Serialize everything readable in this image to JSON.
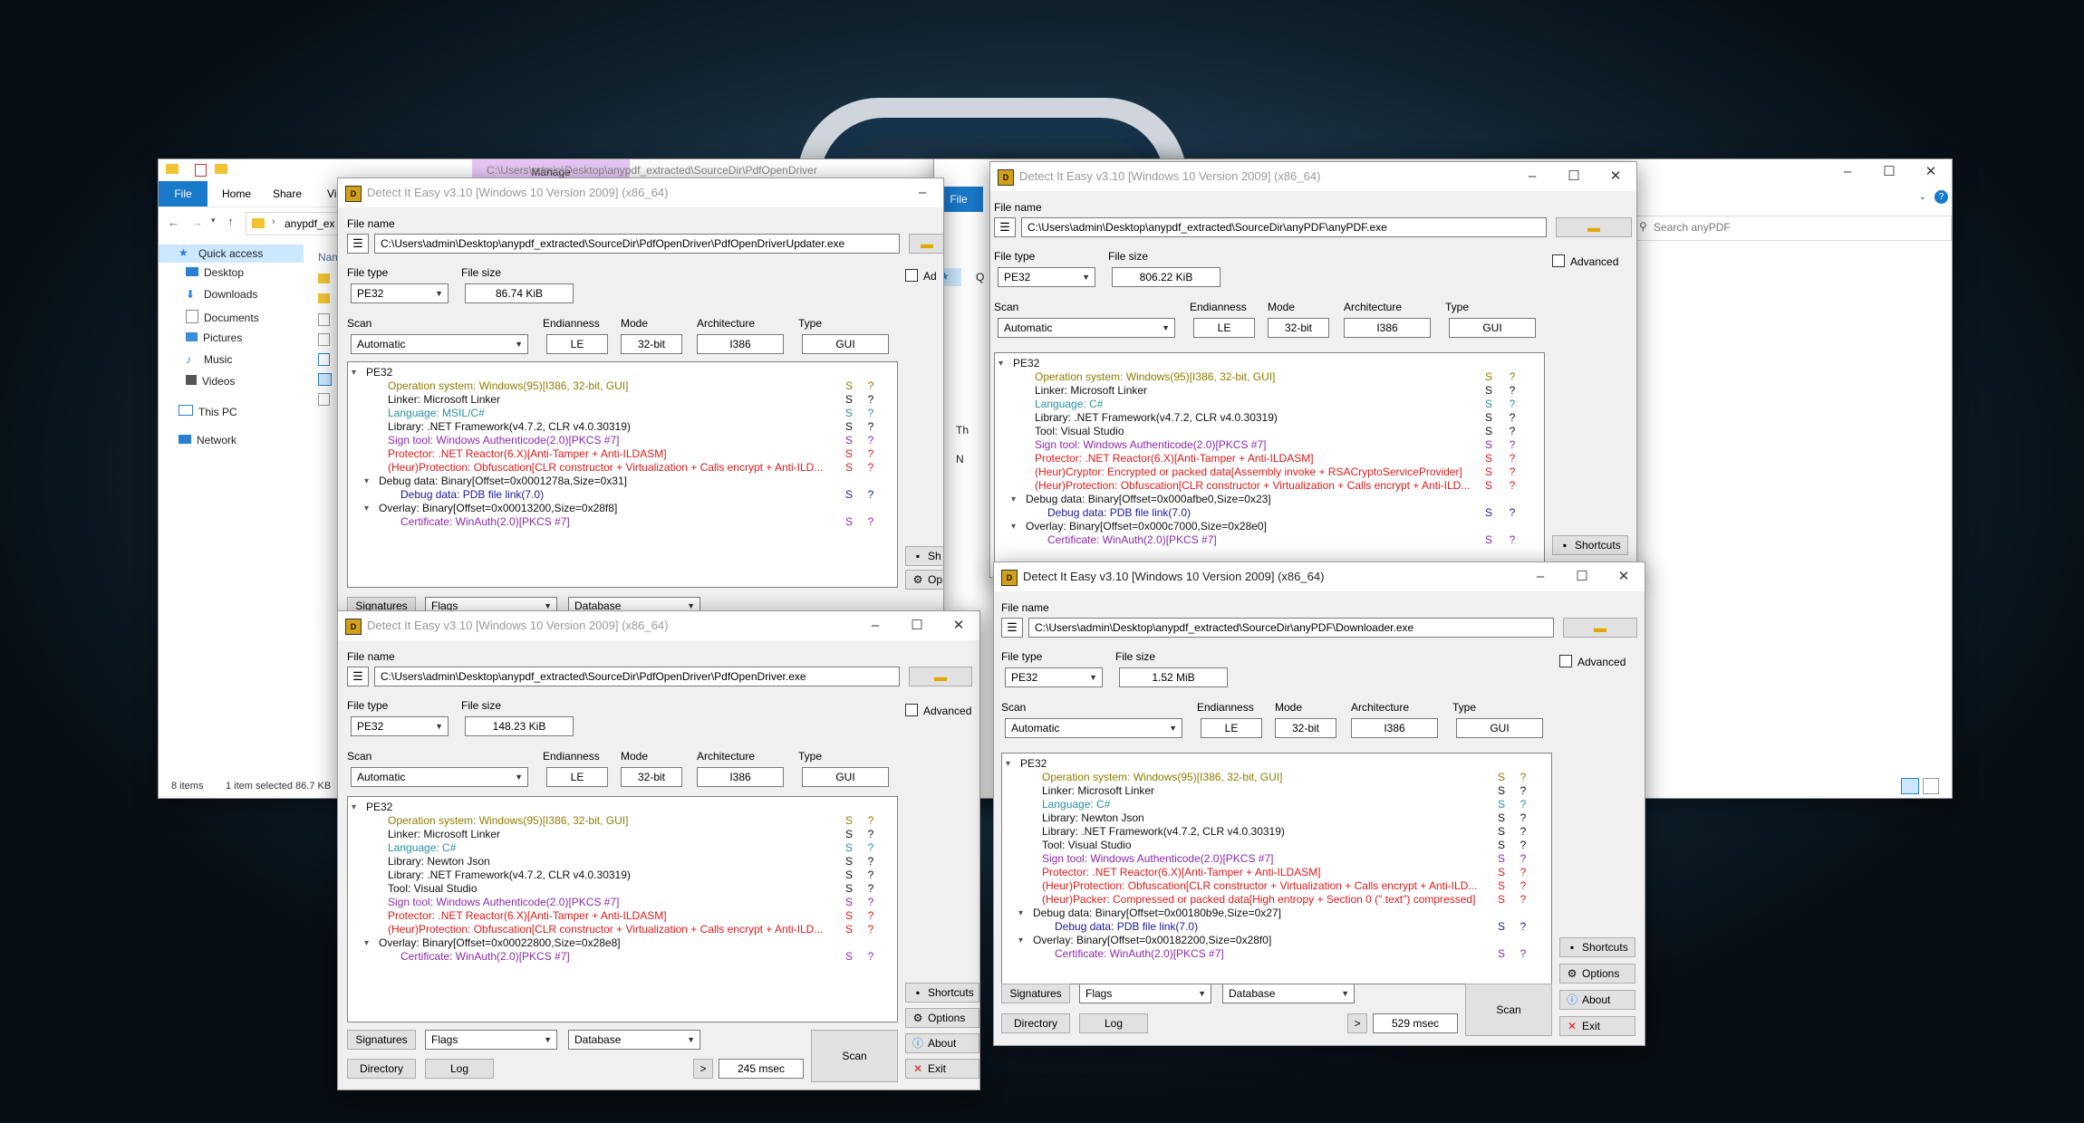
{
  "colors": {
    "teal": "#2a8f9c",
    "olive": "#8b7d00",
    "purple": "#8a2ab0",
    "red": "#e01a1a",
    "navy": "#1a1aa0",
    "black": "#111111"
  },
  "explorer": {
    "manage_tab": "Manage",
    "path_title": "C:\\Users\\admin\\Desktop\\anypdf_extracted\\SourceDir\\PdfOpenDriver",
    "ribbon": {
      "file": "File",
      "home": "Home",
      "share": "Share",
      "view": "Vi"
    },
    "address": "anypdf_ex",
    "column_name": "Nam",
    "nav": [
      {
        "label": "Quick access",
        "icon": "star-icon"
      },
      {
        "label": "Desktop",
        "icon": "desktop-icon"
      },
      {
        "label": "Downloads",
        "icon": "downloads-icon"
      },
      {
        "label": "Documents",
        "icon": "documents-icon"
      },
      {
        "label": "Pictures",
        "icon": "pictures-icon"
      },
      {
        "label": "Music",
        "icon": "music-icon"
      },
      {
        "label": "Videos",
        "icon": "videos-icon"
      },
      {
        "label": "This PC",
        "icon": "pc-icon"
      },
      {
        "label": "Network",
        "icon": "network-icon"
      }
    ],
    "status_items": "8 items",
    "status_selected": "1 item selected  86.7 KB"
  },
  "explorer2": {
    "file": "File",
    "search_placeholder": "Search anyPDF",
    "nav_q": "Q",
    "nav_th": "Th",
    "nav_n": "N"
  },
  "common": {
    "file_name": "File name",
    "file_type": "File type",
    "file_size": "File size",
    "scan": "Scan",
    "endianness": "Endianness",
    "mode": "Mode",
    "architecture": "Architecture",
    "type": "Type",
    "advanced": "Advanced",
    "signatures": "Signatures",
    "flags": "Flags",
    "database": "Database",
    "directory": "Directory",
    "log": "Log",
    "scan_btn": "Scan",
    "next": ">",
    "shortcuts": "Shortcuts",
    "options": "Options",
    "about": "About",
    "exit": "Exit",
    "sh_partial": "Sh",
    "op_partial": "Op",
    "ad_partial": "Ad",
    "s": "S",
    "q": "?"
  },
  "die1": {
    "title": "Detect It Easy v3.10 [Windows 10 Version 2009] (x86_64)",
    "path": "C:\\Users\\admin\\Desktop\\anypdf_extracted\\SourceDir\\PdfOpenDriver\\PdfOpenDriverUpdater.exe",
    "file_type": "PE32",
    "file_size": "86.74 KiB",
    "scan_mode": "Automatic",
    "endianness": "LE",
    "mode": "32-bit",
    "architecture": "I386",
    "type": "GUI",
    "results": [
      {
        "text": "PE32",
        "level": 0,
        "color": "black",
        "exp": true,
        "sq": false
      },
      {
        "text": "Operation system: Windows(95)[I386, 32-bit, GUI]",
        "level": 1,
        "color": "olive",
        "sq": true
      },
      {
        "text": "Linker: Microsoft Linker",
        "level": 1,
        "color": "black",
        "sq": true
      },
      {
        "text": "Language: MSIL/C#",
        "level": 1,
        "color": "teal",
        "sq": true
      },
      {
        "text": "Library: .NET Framework(v4.7.2, CLR v4.0.30319)",
        "level": 1,
        "color": "black",
        "sq": true
      },
      {
        "text": "Sign tool: Windows Authenticode(2.0)[PKCS #7]",
        "level": 1,
        "color": "purple",
        "sq": true
      },
      {
        "text": "Protector: .NET Reactor(6.X)[Anti-Tamper + Anti-ILDASM]",
        "level": 1,
        "color": "red",
        "sq": true
      },
      {
        "text": "(Heur)Protection: Obfuscation[CLR constructor + Virtualization + Calls encrypt + Anti-ILD...",
        "level": 1,
        "color": "red",
        "sq": true
      },
      {
        "text": "Debug data: Binary[Offset=0x0001278a,Size=0x31]",
        "level": 1,
        "color": "black",
        "exp": true,
        "sq": false
      },
      {
        "text": "Debug data: PDB file link(7.0)",
        "level": 2,
        "color": "navy",
        "sq": true
      },
      {
        "text": "Overlay: Binary[Offset=0x00013200,Size=0x28f8]",
        "level": 1,
        "color": "black",
        "exp": true,
        "sq": false
      },
      {
        "text": "Certificate: WinAuth(2.0)[PKCS #7]",
        "level": 2,
        "color": "purple",
        "sq": true
      }
    ]
  },
  "die2": {
    "title": "Detect It Easy v3.10 [Windows 10 Version 2009] (x86_64)",
    "path": "C:\\Users\\admin\\Desktop\\anypdf_extracted\\SourceDir\\PdfOpenDriver\\PdfOpenDriver.exe",
    "file_type": "PE32",
    "file_size": "148.23 KiB",
    "scan_mode": "Automatic",
    "endianness": "LE",
    "mode": "32-bit",
    "architecture": "I386",
    "type": "GUI",
    "time": "245 msec",
    "results": [
      {
        "text": "PE32",
        "level": 0,
        "color": "black",
        "exp": true,
        "sq": false
      },
      {
        "text": "Operation system: Windows(95)[I386, 32-bit, GUI]",
        "level": 1,
        "color": "olive",
        "sq": true
      },
      {
        "text": "Linker: Microsoft Linker",
        "level": 1,
        "color": "black",
        "sq": true
      },
      {
        "text": "Language: C#",
        "level": 1,
        "color": "teal",
        "sq": true
      },
      {
        "text": "Library: Newton Json",
        "level": 1,
        "color": "black",
        "sq": true
      },
      {
        "text": "Library: .NET Framework(v4.7.2, CLR v4.0.30319)",
        "level": 1,
        "color": "black",
        "sq": true
      },
      {
        "text": "Tool: Visual Studio",
        "level": 1,
        "color": "black",
        "sq": true
      },
      {
        "text": "Sign tool: Windows Authenticode(2.0)[PKCS #7]",
        "level": 1,
        "color": "purple",
        "sq": true
      },
      {
        "text": "Protector: .NET Reactor(6.X)[Anti-Tamper + Anti-ILDASM]",
        "level": 1,
        "color": "red",
        "sq": true
      },
      {
        "text": "(Heur)Protection: Obfuscation[CLR constructor + Virtualization + Calls encrypt + Anti-ILD...",
        "level": 1,
        "color": "red",
        "sq": true
      },
      {
        "text": "Overlay: Binary[Offset=0x00022800,Size=0x28e8]",
        "level": 1,
        "color": "black",
        "exp": true,
        "sq": false
      },
      {
        "text": "Certificate: WinAuth(2.0)[PKCS #7]",
        "level": 2,
        "color": "purple",
        "sq": true
      }
    ]
  },
  "die3": {
    "title": "Detect It Easy v3.10 [Windows 10 Version 2009] (x86_64)",
    "path": "C:\\Users\\admin\\Desktop\\anypdf_extracted\\SourceDir\\anyPDF\\anyPDF.exe",
    "file_type": "PE32",
    "file_size": "806.22 KiB",
    "scan_mode": "Automatic",
    "endianness": "LE",
    "mode": "32-bit",
    "architecture": "I386",
    "type": "GUI",
    "results": [
      {
        "text": "PE32",
        "level": 0,
        "color": "black",
        "exp": true,
        "sq": false
      },
      {
        "text": "Operation system: Windows(95)[I386, 32-bit, GUI]",
        "level": 1,
        "color": "olive",
        "sq": true
      },
      {
        "text": "Linker: Microsoft Linker",
        "level": 1,
        "color": "black",
        "sq": true
      },
      {
        "text": "Language: C#",
        "level": 1,
        "color": "teal",
        "sq": true
      },
      {
        "text": "Library: .NET Framework(v4.7.2, CLR v4.0.30319)",
        "level": 1,
        "color": "black",
        "sq": true
      },
      {
        "text": "Tool: Visual Studio",
        "level": 1,
        "color": "black",
        "sq": true
      },
      {
        "text": "Sign tool: Windows Authenticode(2.0)[PKCS #7]",
        "level": 1,
        "color": "purple",
        "sq": true
      },
      {
        "text": "Protector: .NET Reactor(6.X)[Anti-Tamper + Anti-ILDASM]",
        "level": 1,
        "color": "red",
        "sq": true
      },
      {
        "text": "(Heur)Cryptor: Encrypted or packed data[Assembly invoke + RSACryptoServiceProvider]",
        "level": 1,
        "color": "red",
        "sq": true
      },
      {
        "text": "(Heur)Protection: Obfuscation[CLR constructor + Virtualization + Calls encrypt + Anti-ILD...",
        "level": 1,
        "color": "red",
        "sq": true
      },
      {
        "text": "Debug data: Binary[Offset=0x000afbe0,Size=0x23]",
        "level": 1,
        "color": "black",
        "exp": true,
        "sq": false
      },
      {
        "text": "Debug data: PDB file link(7.0)",
        "level": 2,
        "color": "navy",
        "sq": true
      },
      {
        "text": "Overlay: Binary[Offset=0x000c7000,Size=0x28e0]",
        "level": 1,
        "color": "black",
        "exp": true,
        "sq": false
      },
      {
        "text": "Certificate: WinAuth(2.0)[PKCS #7]",
        "level": 2,
        "color": "purple",
        "sq": true
      }
    ]
  },
  "die4": {
    "title": "Detect It Easy v3.10 [Windows 10 Version 2009] (x86_64)",
    "path": "C:\\Users\\admin\\Desktop\\anypdf_extracted\\SourceDir\\anyPDF\\Downloader.exe",
    "file_type": "PE32",
    "file_size": "1.52 MiB",
    "scan_mode": "Automatic",
    "endianness": "LE",
    "mode": "32-bit",
    "architecture": "I386",
    "type": "GUI",
    "time": "529 msec",
    "results": [
      {
        "text": "PE32",
        "level": 0,
        "color": "black",
        "exp": true,
        "sq": false
      },
      {
        "text": "Operation system: Windows(95)[I386, 32-bit, GUI]",
        "level": 1,
        "color": "olive",
        "sq": true
      },
      {
        "text": "Linker: Microsoft Linker",
        "level": 1,
        "color": "black",
        "sq": true
      },
      {
        "text": "Language: C#",
        "level": 1,
        "color": "teal",
        "sq": true
      },
      {
        "text": "Library: Newton Json",
        "level": 1,
        "color": "black",
        "sq": true
      },
      {
        "text": "Library: .NET Framework(v4.7.2, CLR v4.0.30319)",
        "level": 1,
        "color": "black",
        "sq": true
      },
      {
        "text": "Tool: Visual Studio",
        "level": 1,
        "color": "black",
        "sq": true
      },
      {
        "text": "Sign tool: Windows Authenticode(2.0)[PKCS #7]",
        "level": 1,
        "color": "purple",
        "sq": true
      },
      {
        "text": "Protector: .NET Reactor(6.X)[Anti-Tamper + Anti-ILDASM]",
        "level": 1,
        "color": "red",
        "sq": true
      },
      {
        "text": "(Heur)Protection: Obfuscation[CLR constructor + Virtualization + Calls encrypt + Anti-ILD...",
        "level": 1,
        "color": "red",
        "sq": true
      },
      {
        "text": "(Heur)Packer: Compressed or packed data[High entropy + Section 0 (\".text\") compressed]",
        "level": 1,
        "color": "red",
        "sq": true
      },
      {
        "text": "Debug data: Binary[Offset=0x00180b9e,Size=0x27]",
        "level": 1,
        "color": "black",
        "exp": true,
        "sq": false
      },
      {
        "text": "Debug data: PDB file link(7.0)",
        "level": 2,
        "color": "navy",
        "sq": true
      },
      {
        "text": "Overlay: Binary[Offset=0x00182200,Size=0x28f0]",
        "level": 1,
        "color": "black",
        "exp": true,
        "sq": false
      },
      {
        "text": "Certificate: WinAuth(2.0)[PKCS #7]",
        "level": 2,
        "color": "purple",
        "sq": true
      }
    ]
  }
}
